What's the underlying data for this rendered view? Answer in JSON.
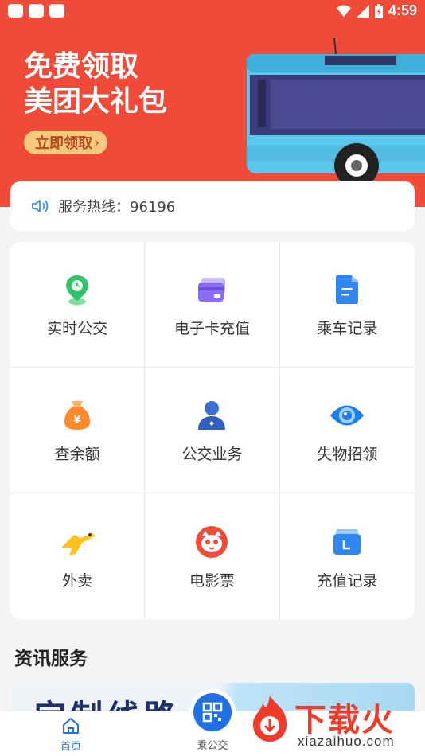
{
  "status_bar": {
    "time": "4:59"
  },
  "banner": {
    "title_line1": "免费领取",
    "title_line2": "美团大礼包",
    "button_label": "立即领取",
    "button_chevron": "›"
  },
  "hotline": {
    "text": "服务热线：96196"
  },
  "grid": [
    {
      "label": "实时公交",
      "icon": "location-pin-icon"
    },
    {
      "label": "电子卡充值",
      "icon": "card-icon"
    },
    {
      "label": "乘车记录",
      "icon": "document-icon"
    },
    {
      "label": "查余额",
      "icon": "money-bag-icon"
    },
    {
      "label": "公交业务",
      "icon": "person-icon"
    },
    {
      "label": "失物招领",
      "icon": "eye-icon"
    },
    {
      "label": "外卖",
      "icon": "kangaroo-icon"
    },
    {
      "label": "电影票",
      "icon": "cat-icon"
    },
    {
      "label": "充值记录",
      "icon": "wallet-icon"
    }
  ],
  "section": {
    "title": "资讯服务"
  },
  "news": {
    "text": "定制线路"
  },
  "tabbar": {
    "home": "首页",
    "bus": "乘公交"
  },
  "watermark": {
    "text": "下载火",
    "url": "xiazaihuo.com"
  },
  "colors": {
    "brand_red": "#f04a38",
    "primary_blue": "#1f6fe5"
  }
}
